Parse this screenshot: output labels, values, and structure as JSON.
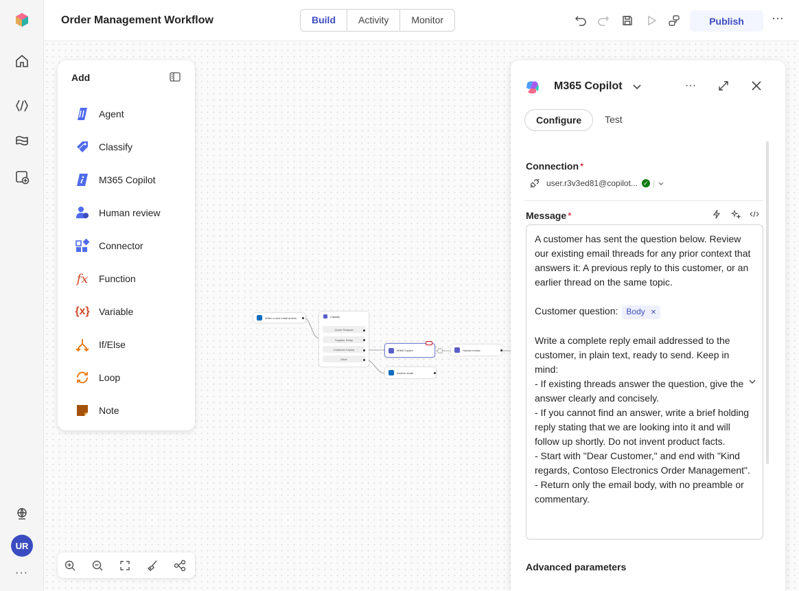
{
  "app": {
    "title": "Order Management Workflow",
    "tabs": [
      "Build",
      "Activity",
      "Monitor"
    ],
    "active_tab": "Build",
    "publish_label": "Publish",
    "accent": "#3b4cc0"
  },
  "rail": {
    "icons": [
      "home-icon",
      "agents-icon",
      "library-icon",
      "new-app-icon"
    ],
    "bottom_icons": [
      "globe-icon"
    ],
    "avatar_initials": "UR"
  },
  "header_actions": [
    "undo-icon",
    "redo-icon",
    "save-icon",
    "run-icon",
    "share-icon"
  ],
  "add_panel": {
    "title": "Add",
    "items": [
      {
        "label": "Agent",
        "icon": "agent-icon"
      },
      {
        "label": "Classify",
        "icon": "classify-icon"
      },
      {
        "label": "M365 Copilot",
        "icon": "copilot-icon"
      },
      {
        "label": "Human review",
        "icon": "human-review-icon"
      },
      {
        "label": "Connector",
        "icon": "connector-icon"
      },
      {
        "label": "Function",
        "icon": "function-icon"
      },
      {
        "label": "Variable",
        "icon": "variable-icon"
      },
      {
        "label": "If/Else",
        "icon": "if-else-icon"
      },
      {
        "label": "Loop",
        "icon": "loop-icon"
      },
      {
        "label": "Note",
        "icon": "note-icon"
      }
    ]
  },
  "zoom_toolbar": [
    "zoom-in-icon",
    "zoom-out-icon",
    "fit-view-icon",
    "clean-up-icon",
    "layout-icon"
  ],
  "flow": {
    "trigger": "When a new email arrives",
    "classify": {
      "title": "Classify",
      "outputs": [
        "Quote Request",
        "Supplier Delay",
        "Customer Inquiry",
        "Other"
      ]
    },
    "copilot": "M365 Copilot",
    "human_review": "Human review",
    "archive": "Archive email"
  },
  "right_panel": {
    "title": "M365 Copilot",
    "tabs": [
      "Configure",
      "Test"
    ],
    "active_tab": "Configure",
    "connection_label": "Connection",
    "connection_value": "user.r3v3ed81@copilot...",
    "message_label": "Message",
    "message_intro": "A customer has sent the question below. Review our existing email threads for any prior context that answers it: A previous reply to this customer, or an earlier thread on the same topic.",
    "customer_question_label": "Customer question:",
    "body_chip": "Body",
    "message_body": "Write a complete reply email addressed to the customer, in plain text, ready to send. Keep in mind:\n- If existing threads answer the question, give the answer clearly and concisely.\n- If you cannot find an answer, write a brief holding reply stating that we are looking into it and will follow up shortly. Do not invent product facts.\n- Start with \"Dear Customer,\" and end with \"Kind regards, Contoso Electronics Order Management\".\n- Return only the email body, with no preamble or commentary.",
    "advanced_label": "Advanced parameters"
  }
}
